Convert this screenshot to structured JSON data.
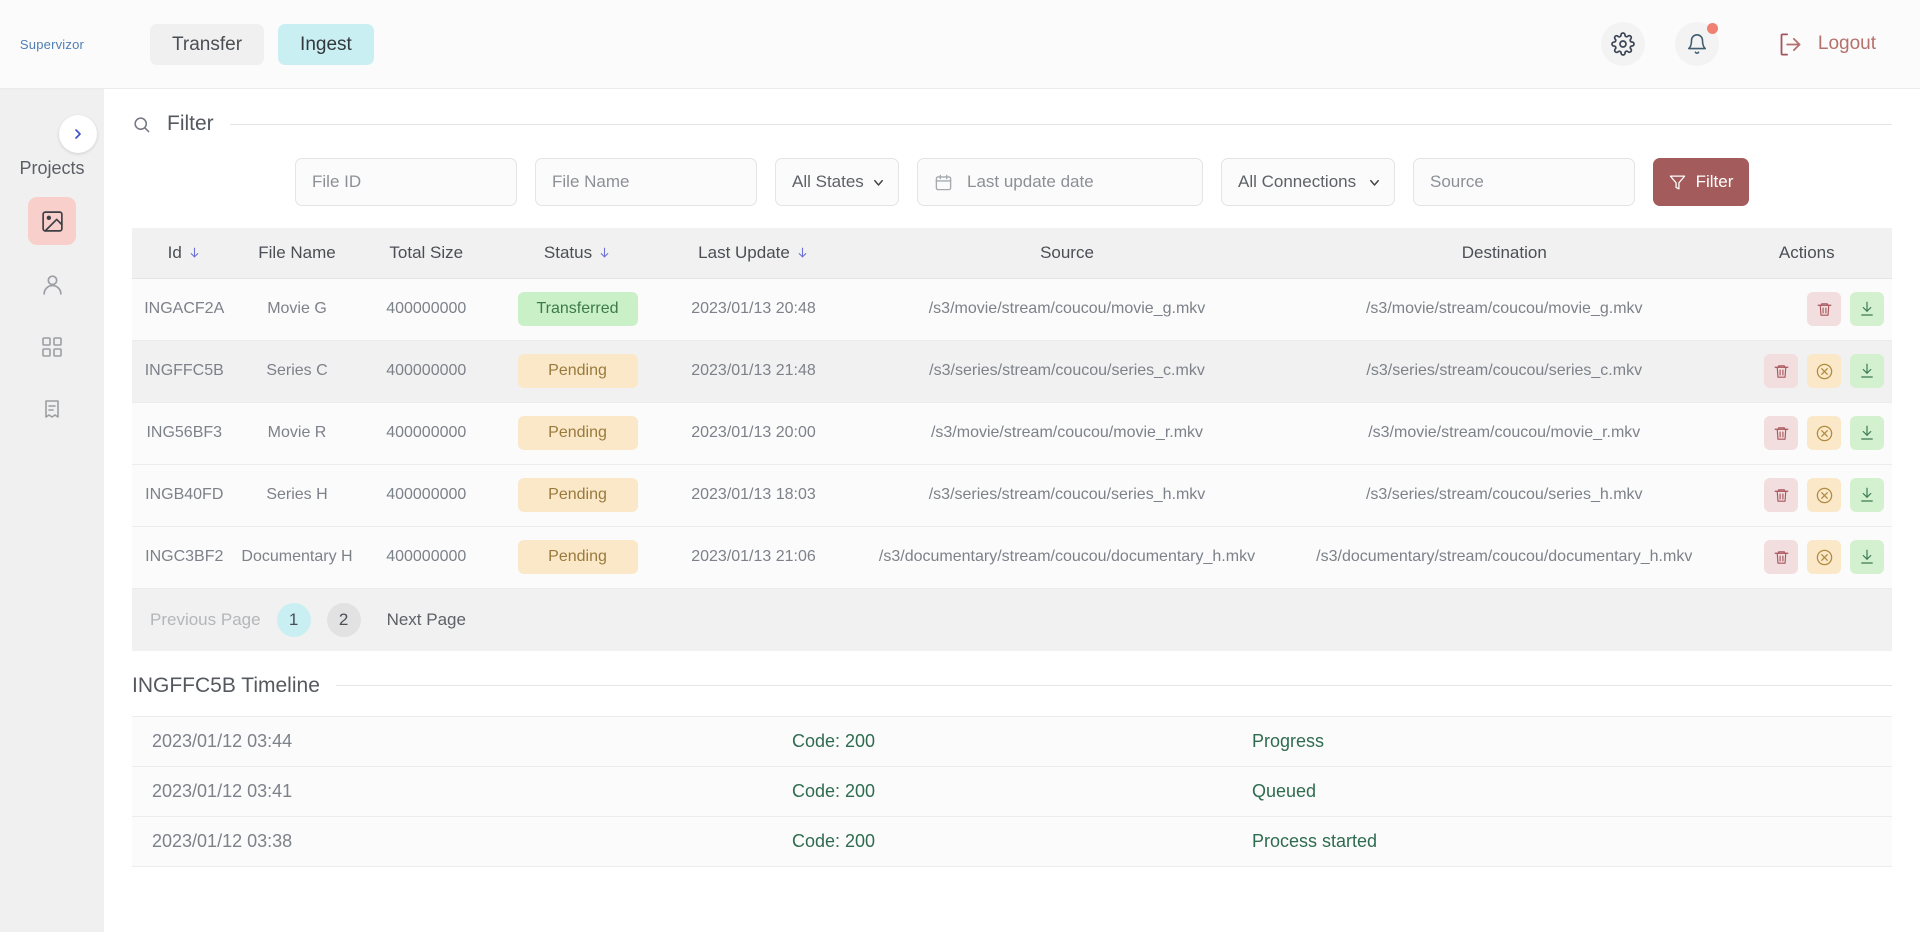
{
  "brand": {
    "name": "Supervizor"
  },
  "nav": {
    "tabs": [
      {
        "label": "Transfer",
        "active": false
      },
      {
        "label": "Ingest",
        "active": true
      }
    ]
  },
  "topbar": {
    "settings_icon": "gear-icon",
    "notifications_icon": "bell-icon",
    "logout_icon": "logout-icon",
    "logout_label": "Logout"
  },
  "sidebar": {
    "expand_icon": "chevron-right-icon",
    "title": "Projects",
    "items": [
      {
        "icon": "image-icon",
        "active": true
      },
      {
        "icon": "user-icon",
        "active": false
      },
      {
        "icon": "grid-icon",
        "active": false
      },
      {
        "icon": "receipt-icon",
        "active": false
      }
    ]
  },
  "filter": {
    "search_icon": "search-icon",
    "title": "Filter",
    "file_id_placeholder": "File ID",
    "file_id_value": "",
    "file_name_placeholder": "File Name",
    "file_name_value": "",
    "states_selected": "All States",
    "states_options": [
      "All States"
    ],
    "date_icon": "calendar-icon",
    "date_placeholder": "Last update date",
    "date_value": "",
    "connections_selected": "All Connections",
    "connections_options": [
      "All Connections"
    ],
    "source_placeholder": "Source",
    "source_value": "",
    "button_icon": "funnel-icon",
    "button_label": "Filter"
  },
  "table": {
    "columns": [
      {
        "label": "Id",
        "sortable": true
      },
      {
        "label": "File Name",
        "sortable": false
      },
      {
        "label": "Total Size",
        "sortable": false
      },
      {
        "label": "Status",
        "sortable": true
      },
      {
        "label": "Last Update",
        "sortable": true
      },
      {
        "label": "Source",
        "sortable": false
      },
      {
        "label": "Destination",
        "sortable": false
      },
      {
        "label": "Actions",
        "sortable": false
      }
    ],
    "rows": [
      {
        "id": "INGACF2A",
        "file_name": "Movie G",
        "total_size": "400000000",
        "status": "Transferred",
        "status_kind": "transferred",
        "last_update": "2023/01/13 20:48",
        "source": "/s3/movie/stream/coucou/movie_g.mkv",
        "destination": "/s3/movie/stream/coucou/movie_g.mkv",
        "selected": false,
        "can_cancel": false
      },
      {
        "id": "INGFFC5B",
        "file_name": "Series C",
        "total_size": "400000000",
        "status": "Pending",
        "status_kind": "pending",
        "last_update": "2023/01/13 21:48",
        "source": "/s3/series/stream/coucou/series_c.mkv",
        "destination": "/s3/series/stream/coucou/series_c.mkv",
        "selected": true,
        "can_cancel": true
      },
      {
        "id": "ING56BF3",
        "file_name": "Movie R",
        "total_size": "400000000",
        "status": "Pending",
        "status_kind": "pending",
        "last_update": "2023/01/13 20:00",
        "source": "/s3/movie/stream/coucou/movie_r.mkv",
        "destination": "/s3/movie/stream/coucou/movie_r.mkv",
        "selected": false,
        "can_cancel": true
      },
      {
        "id": "INGB40FD",
        "file_name": "Series H",
        "total_size": "400000000",
        "status": "Pending",
        "status_kind": "pending",
        "last_update": "2023/01/13 18:03",
        "source": "/s3/series/stream/coucou/series_h.mkv",
        "destination": "/s3/series/stream/coucou/series_h.mkv",
        "selected": false,
        "can_cancel": true
      },
      {
        "id": "INGC3BF2",
        "file_name": "Documentary H",
        "total_size": "400000000",
        "status": "Pending",
        "status_kind": "pending",
        "last_update": "2023/01/13 21:06",
        "source": "/s3/documentary/stream/coucou/documentary_h.mkv",
        "destination": "/s3/documentary/stream/coucou/documentary_h.mkv",
        "selected": false,
        "can_cancel": true
      }
    ],
    "actions": {
      "delete_icon": "trash-icon",
      "cancel_icon": "cancel-circle-icon",
      "download_icon": "download-icon"
    }
  },
  "pagination": {
    "previous_label": "Previous Page",
    "next_label": "Next Page",
    "pages": [
      "1",
      "2"
    ],
    "current_page": "1"
  },
  "timeline": {
    "title": "INGFFC5B Timeline",
    "entries": [
      {
        "date": "2023/01/12 03:44",
        "code": "Code: 200",
        "message": "Progress"
      },
      {
        "date": "2023/01/12 03:41",
        "code": "Code: 200",
        "message": "Queued"
      },
      {
        "date": "2023/01/12 03:38",
        "code": "Code: 200",
        "message": "Process started"
      }
    ]
  },
  "colors": {
    "accent_pink": "#f8cfcb",
    "brand_blue": "#4f7fb5",
    "filter_button": "#a45b5b",
    "active_tab": "#c9eff2",
    "status_transferred_bg": "#c9f0c7",
    "status_transferred_fg": "#3e7a49",
    "status_pending_bg": "#fae8c8",
    "status_pending_fg": "#9a7a3c",
    "timeline_text": "#2e6b4f",
    "notification_dot": "#f08072"
  }
}
